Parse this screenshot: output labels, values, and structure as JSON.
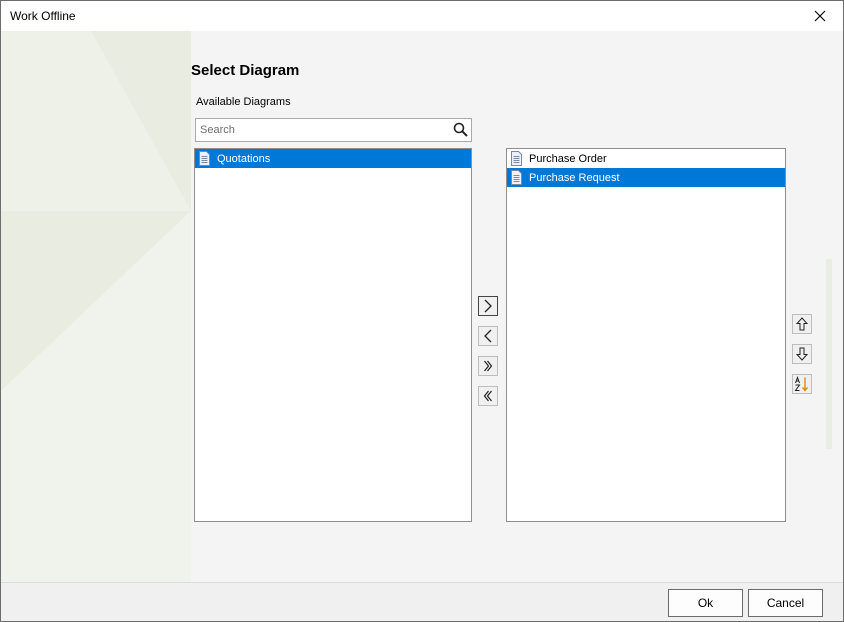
{
  "window": {
    "title": "Work Offline"
  },
  "dialog": {
    "heading": "Select Diagram",
    "available_label": "Available Diagrams",
    "search": {
      "placeholder": "Search",
      "value": ""
    },
    "available": [
      {
        "label": "Quotations",
        "icon": "document-icon",
        "selected": true
      }
    ],
    "selected": [
      {
        "label": "Purchase Order",
        "icon": "document-icon",
        "selected": false
      },
      {
        "label": "Purchase Request",
        "icon": "document-icon",
        "selected": true
      }
    ],
    "move_buttons": [
      "move-right",
      "move-left",
      "move-all-right",
      "move-all-left"
    ],
    "order_buttons": [
      "move-up",
      "move-down",
      "sort-alphabetical"
    ]
  },
  "footer": {
    "ok_label": "Ok",
    "cancel_label": "Cancel"
  },
  "colors": {
    "selection": "#0078d7",
    "sort_arrow": "#e8860b"
  }
}
